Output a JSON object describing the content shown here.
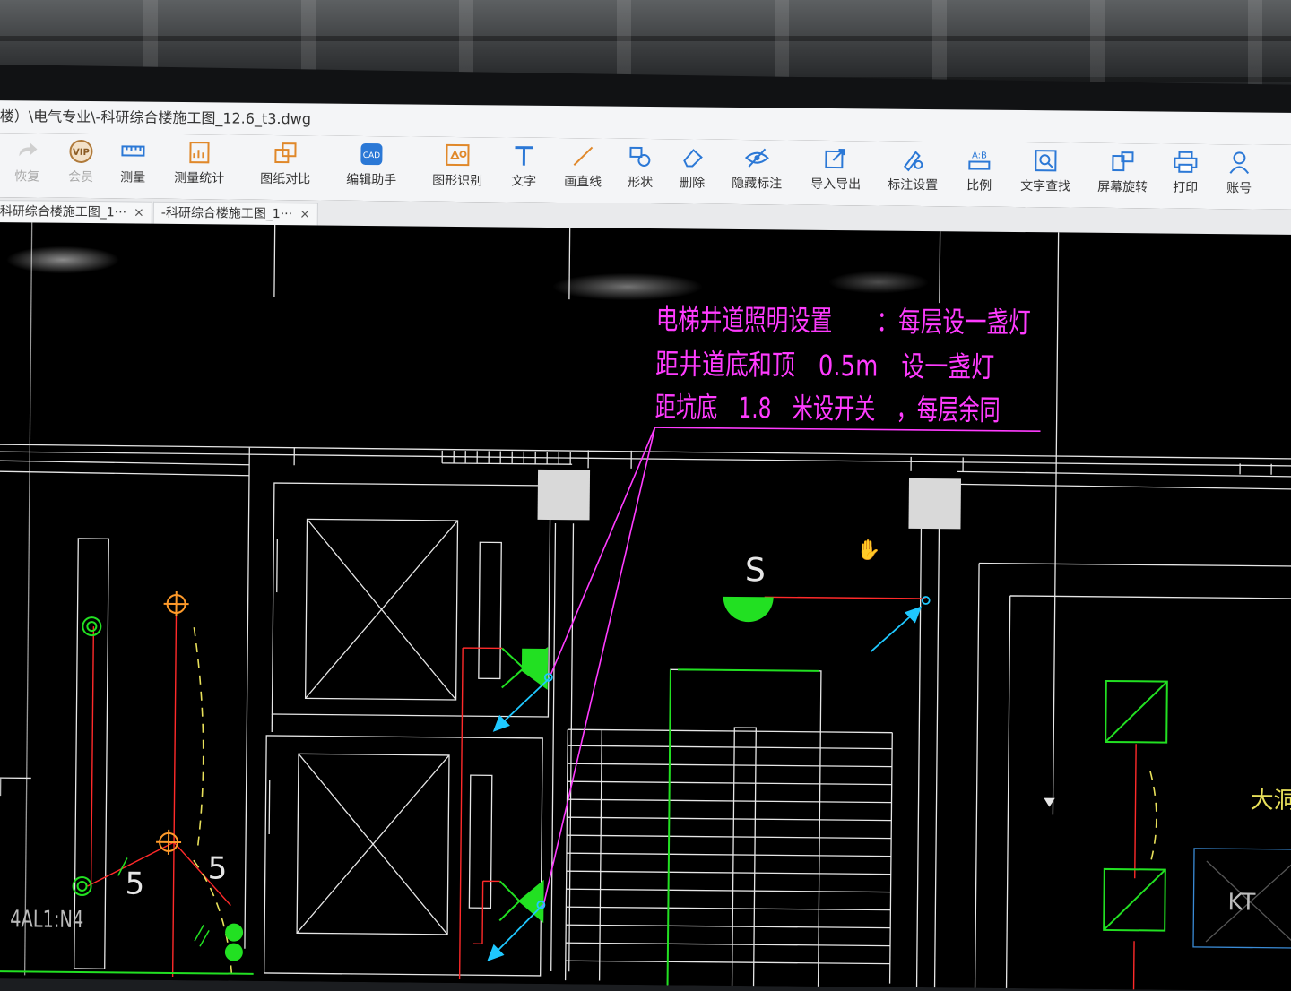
{
  "window": {
    "title": "楼）\\电气专业\\-科研综合楼施工图_12.6_t3.dwg"
  },
  "toolbar": {
    "items": [
      {
        "label": "恢复"
      },
      {
        "label": "会员"
      },
      {
        "label": "测量"
      },
      {
        "label": "测量统计"
      },
      {
        "label": "图纸对比"
      },
      {
        "label": "编辑助手"
      },
      {
        "label": "图形识别"
      },
      {
        "label": "文字"
      },
      {
        "label": "画直线"
      },
      {
        "label": "形状"
      },
      {
        "label": "删除"
      },
      {
        "label": "隐藏标注"
      },
      {
        "label": "导入导出"
      },
      {
        "label": "标注设置"
      },
      {
        "label": "比例"
      },
      {
        "label": "文字查找"
      },
      {
        "label": "屏幕旋转"
      },
      {
        "label": "打印"
      },
      {
        "label": "账号"
      }
    ]
  },
  "tabs": [
    {
      "label": "科研综合楼施工图_1···",
      "close": "×"
    },
    {
      "label": "-科研综合楼施工图_1···",
      "close": "×"
    }
  ],
  "drawing": {
    "note_line1": "电梯井道照明设置　　：每层设一盏灯",
    "note_line2": "距井道底和顶　0.5m　设一盏灯",
    "note_line3": "距坑底　1.8　米设开关　，每层余同",
    "switch_label": "S",
    "circuit_label": "4AL1:N4",
    "num_left": "5",
    "num_right": "5",
    "kt_label": "KT",
    "edge_text": "大洞",
    "colors": {
      "magenta": "#ff3cff",
      "green": "#22e022",
      "red": "#ff2a2a",
      "cyan": "#1fc8ff",
      "yellow": "#e8e05a",
      "white": "#e6e6e6"
    }
  }
}
